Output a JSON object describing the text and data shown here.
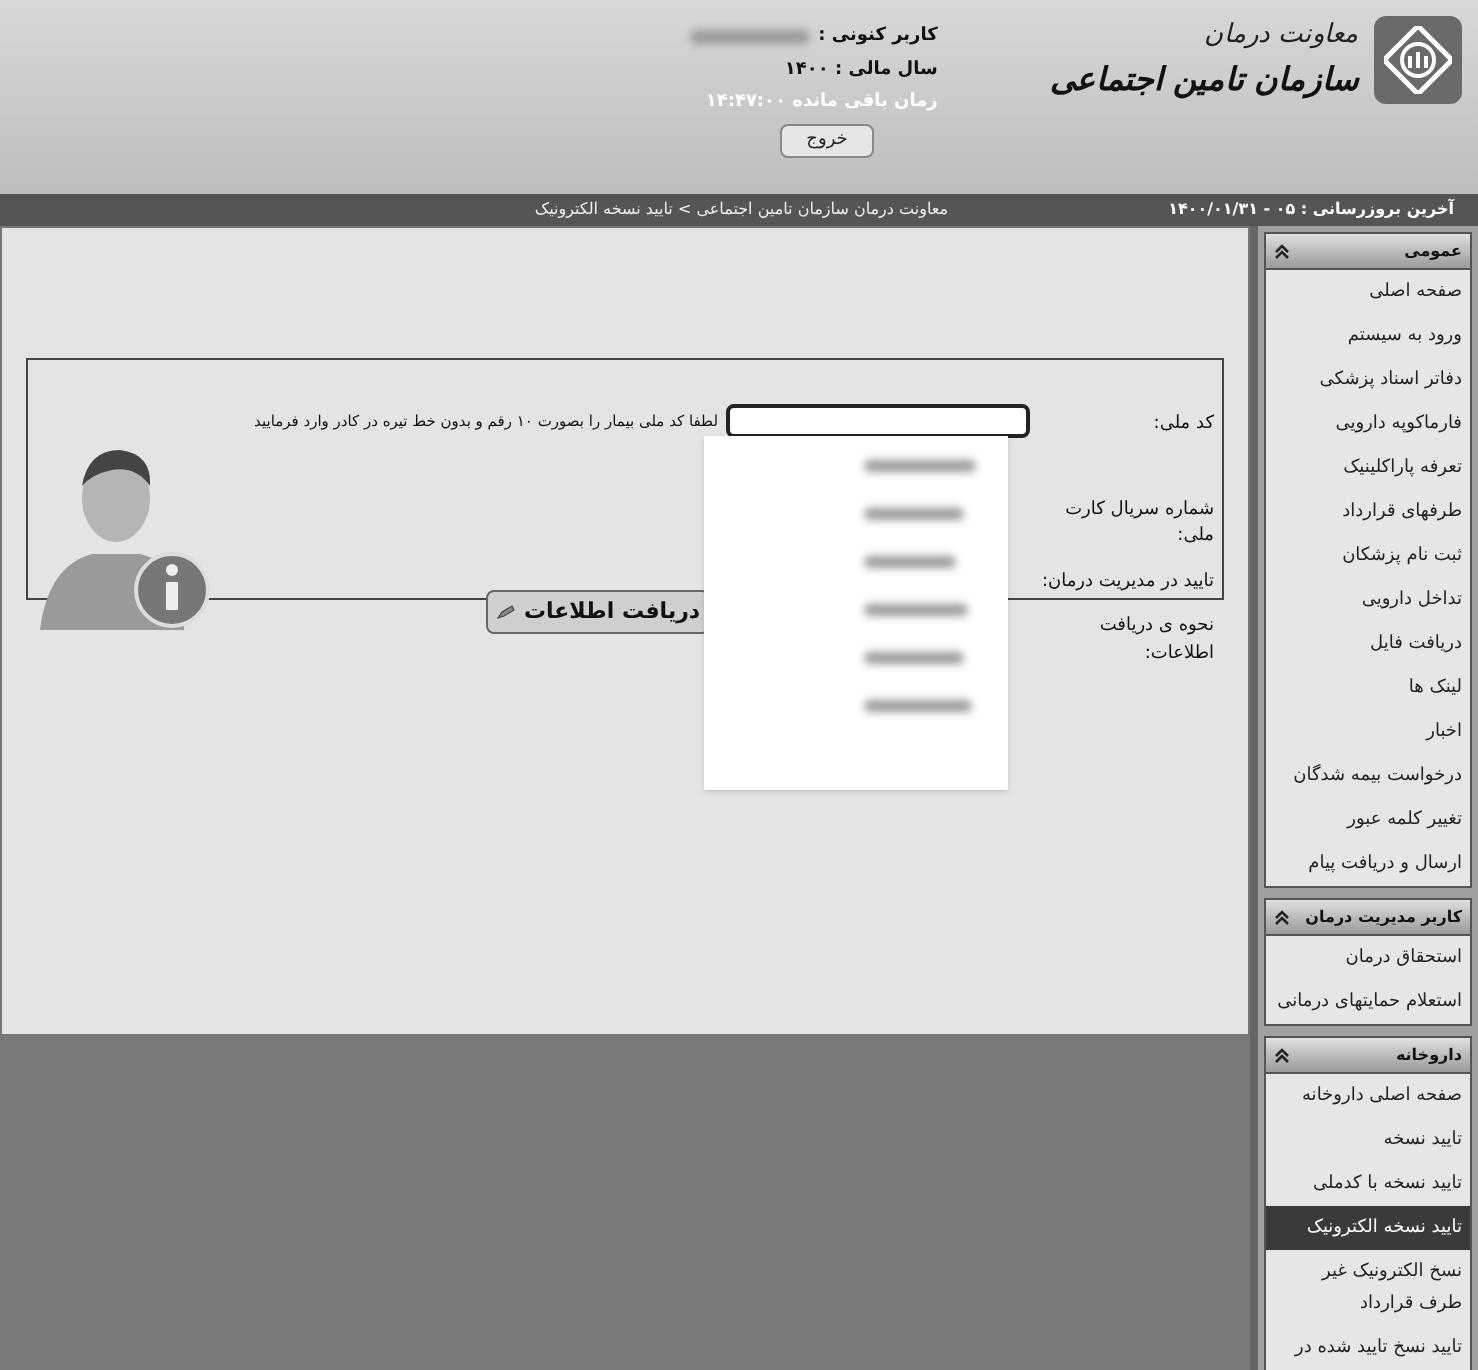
{
  "header": {
    "logo_title": "معاونت درمان",
    "logo_subtitle": "سازمان تامین اجتماعی",
    "current_user_label": "کاربر کنونی :",
    "fiscal_year": "سال مالی : ۱۴۰۰",
    "remaining_time": "زمان باقی مانده ۱۴:۴۷:۰۰",
    "exit_button": "خروج"
  },
  "breadcrumb": "معاونت درمان سازمان تامین اجتماعی > تایید نسخه الکترونیک",
  "last_update": "آخرین بروزرسانی : ۰۵ - ۱۴۰۰/۰۱/۳۱",
  "form": {
    "fields": [
      {
        "label": "کد ملی:",
        "hint": "لطفا کد ملی بیمار را بصورت ۱۰ رقم و بدون خط تیره در کادر وارد فرمایید"
      },
      {
        "label": "شماره سریال کارت ملی:"
      },
      {
        "label": "تایید در مدیریت درمان:"
      },
      {
        "label": "نحوه ی دریافت اطلاعات:"
      }
    ],
    "submit_button": "دریافت اطلاعات",
    "suggestions_open": true
  },
  "sidebar": {
    "sections": [
      {
        "title": "عمومی",
        "expanded": true,
        "items": [
          {
            "label": "صفحه اصلی",
            "selected": false
          },
          {
            "label": "ورود به سیستم",
            "selected": false
          },
          {
            "label": "دفاتر اسناد پزشکی",
            "selected": false
          },
          {
            "label": "فارماکوپه دارویی",
            "selected": false
          },
          {
            "label": "تعرفه پاراکلینیک",
            "selected": false
          },
          {
            "label": "طرفهای قرارداد",
            "selected": false
          },
          {
            "label": "ثبت نام پزشکان",
            "selected": false
          },
          {
            "label": "تداخل دارویی",
            "selected": false
          },
          {
            "label": "دریافت فایل",
            "selected": false
          },
          {
            "label": "لینک ها",
            "selected": false
          },
          {
            "label": "اخبار",
            "selected": false
          },
          {
            "label": "درخواست بیمه شدگان",
            "selected": false
          },
          {
            "label": "تغییر کلمه عبور",
            "selected": false
          },
          {
            "label": "ارسال و دریافت پیام",
            "selected": false
          }
        ]
      },
      {
        "title": "کاربر مدیریت درمان",
        "expanded": true,
        "items": [
          {
            "label": "استحقاق درمان",
            "selected": false
          },
          {
            "label": "استعلام حمایتهای درمانی",
            "selected": false
          }
        ]
      },
      {
        "title": "داروخانه",
        "expanded": true,
        "items": [
          {
            "label": "صفحه اصلی داروخانه",
            "selected": false
          },
          {
            "label": "تایید نسخه",
            "selected": false
          },
          {
            "label": "تایید نسخه با کدملی",
            "selected": false
          },
          {
            "label": "تایید نسخه الکترونیک",
            "selected": true
          },
          {
            "label": "نسخ الکترونیک غیر طرف قرارداد",
            "selected": false
          },
          {
            "label": "تایید نسخ تایید شده در",
            "selected": false
          }
        ]
      }
    ]
  }
}
